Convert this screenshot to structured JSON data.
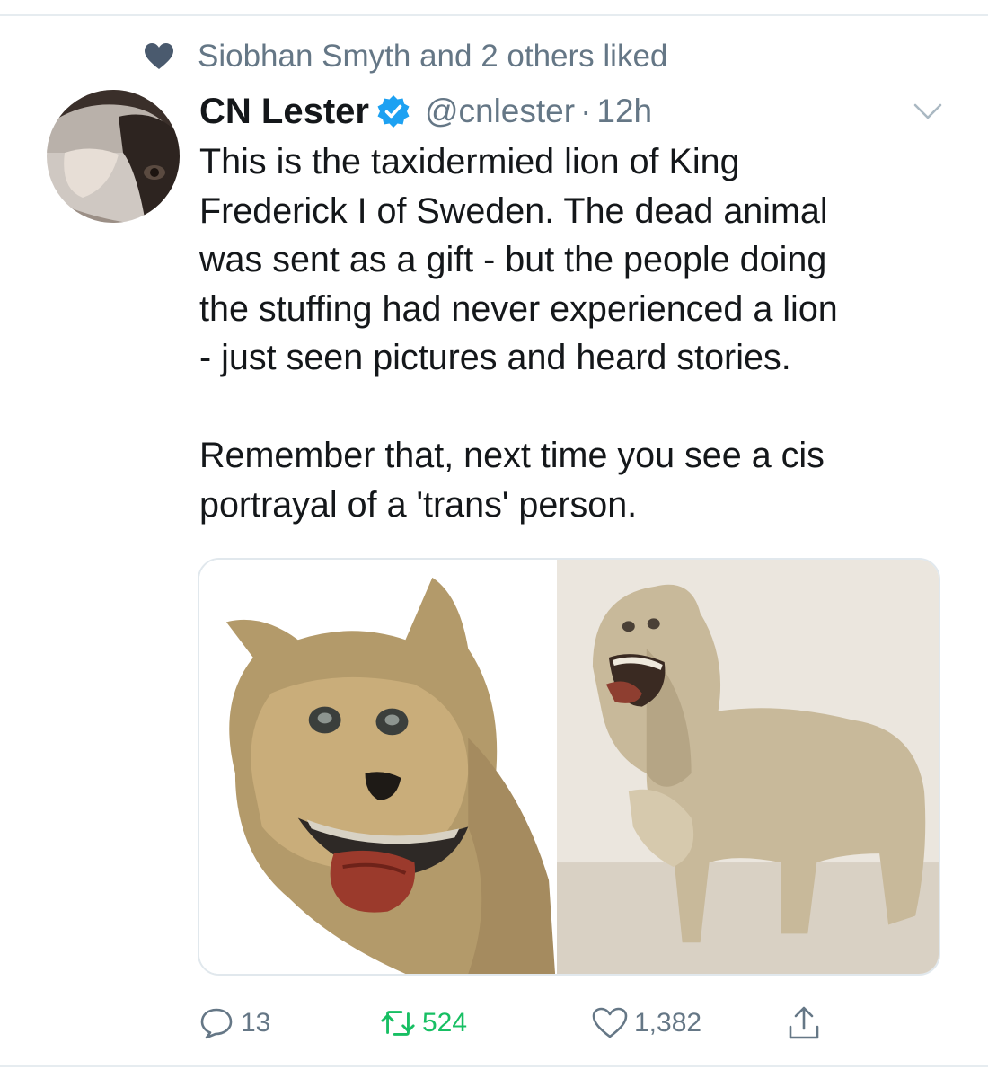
{
  "social_context": {
    "icon": "heart-icon",
    "text": "Siobhan Smyth and 2 others liked"
  },
  "tweet": {
    "author_name": "CN Lester",
    "verified": true,
    "handle": "@cnlester",
    "separator": "·",
    "time": "12h",
    "text_lines": [
      "This is the taxidermied lion of King",
      "Frederick I of Sweden. The dead animal",
      "was sent as a gift - but the people doing",
      "the stuffing had never experienced a lion",
      "- just seen pictures and heard stories."
    ],
    "text_lines_2": [
      "Remember that, next time you see a cis",
      "portrayal of a 'trans' person."
    ]
  },
  "actions": {
    "reply_count": "13",
    "retweet_count": "524",
    "like_count": "1,382"
  },
  "colors": {
    "secondary_text": "#657786",
    "verified_blue": "#1da1f2",
    "retweet_green": "#17bf63",
    "divider": "#e6ecf0"
  }
}
